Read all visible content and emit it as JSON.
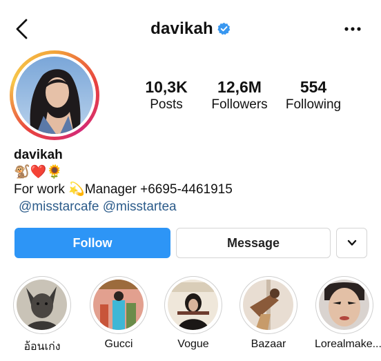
{
  "header": {
    "username": "davikah",
    "back_icon": "chevron-left-icon",
    "verified_icon": "verified-badge-icon",
    "more_icon": "more-horizontal-icon",
    "verified_color": "#3897f0"
  },
  "stats": [
    {
      "value": "10,3K",
      "label": "Posts"
    },
    {
      "value": "12,6M",
      "label": "Followers"
    },
    {
      "value": "554",
      "label": "Following"
    }
  ],
  "bio": {
    "name": "davikah",
    "emoji_line": "🐒❤️🌻",
    "work_prefix": "For work ",
    "work_emoji": "💫",
    "work_text": "Manager  +6695-4461915",
    "mention_1": "@misstarcafe",
    "mention_2": "@misstartea"
  },
  "actions": {
    "follow": "Follow",
    "message": "Message",
    "dropdown_icon": "chevron-down-icon",
    "follow_color": "#2d95f6"
  },
  "highlights": [
    {
      "label": "อ้อนเก่ง"
    },
    {
      "label": "Gucci"
    },
    {
      "label": "Vogue"
    },
    {
      "label": "Bazaar"
    },
    {
      "label": "Lorealmake..."
    }
  ]
}
